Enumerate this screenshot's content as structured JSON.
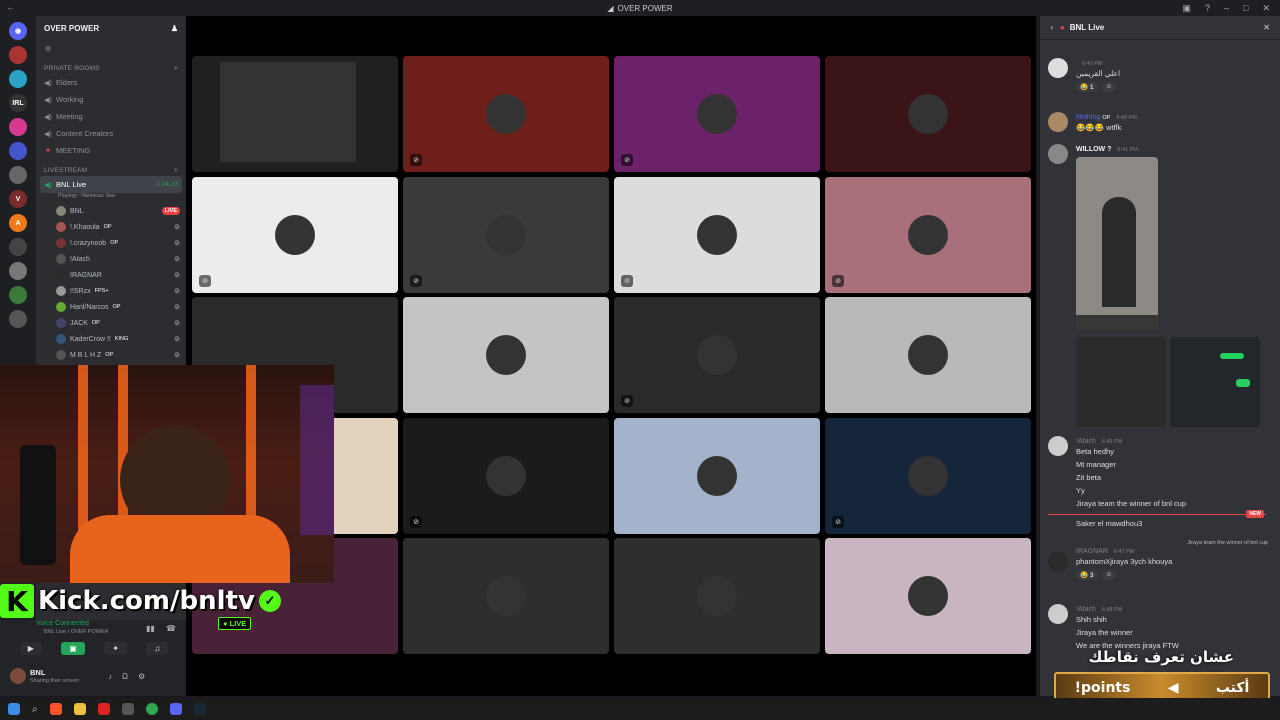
{
  "window": {
    "title": "OVER POWER"
  },
  "server": {
    "name": "OVER POWER"
  },
  "sidebar": {
    "private_category": "PRIVATE ROOMS",
    "private_channels": [
      "Elders",
      "Working",
      "Meeting",
      "Content Creators",
      "MEETING"
    ],
    "livestream_category": "LIVESTREAM",
    "active_channel": {
      "name": "BNL Live",
      "timer": "1:24:23",
      "playing": "Playing: ~Nemesis Star"
    },
    "voice_users": [
      {
        "name": "BNL",
        "badge": "LIVE"
      },
      {
        "name": "!.Khaoula",
        "tag": "OP"
      },
      {
        "name": "!.crazynoob",
        "tag": "OP"
      },
      {
        "name": "!Atach"
      },
      {
        "name": "IRAGNAR"
      },
      {
        "name": "!!SRzx",
        "tag": "FPS+"
      },
      {
        "name": "Hanl/Narcos",
        "tag": "OP"
      },
      {
        "name": "JACK",
        "tag": "OP"
      },
      {
        "name": "KaderCrow !!",
        "tag": "KING"
      },
      {
        "name": "M B L H Z",
        "tag": "OP"
      }
    ]
  },
  "voice": {
    "status": "Voice Connected",
    "location": "BNL Live / OVER POWER"
  },
  "user": {
    "name": "BNL",
    "status": "Sharing their screen"
  },
  "overlay": {
    "handle": "Kick.com/bnltv",
    "live": "LIVE"
  },
  "chat": {
    "title": "BNL Live",
    "messages": [
      {
        "author": "",
        "time": "6:40 PM",
        "text": "اعلي القريمين",
        "reaction": "1"
      },
      {
        "author": "Nothing",
        "tag": "OP",
        "time": "6:40 PM",
        "text": "wtffk"
      },
      {
        "author": "WILLOW ?",
        "time": "6:41 PM",
        "text": ""
      },
      {
        "author": "!Atach",
        "time": "6:46 PM",
        "lines": [
          "Beta hedhy",
          "Mt manager",
          "Zit beta",
          "Yy",
          "Jiraya team the winner of bnl cup",
          "Saker el mawdhou3"
        ],
        "new": "NEW"
      },
      {
        "author": "IRAGNAR",
        "time": "6:47 PM",
        "reply": "Jiraya team the winner of bnl cup",
        "text": "phantomXjiraya 3ych khouya",
        "reaction": "3"
      },
      {
        "author": "!Atach",
        "time": "6:48 PM",
        "lines": [
          "Shih shih",
          "Jiraya the winner",
          "We are the winners jiraya FTW"
        ]
      }
    ]
  },
  "promo": {
    "arabic": "عشان تعرف نقاطك",
    "command": "!points",
    "cta": "أكتب"
  },
  "tile_colors": [
    "#1e1e1e",
    "#6e1f1a",
    "#6b2268",
    "#3b1418",
    "#ececec",
    "#3a3a3a",
    "#dcdcdc",
    "#a8707a",
    "#2a2a2a",
    "#c4c4c4",
    "#2a2a2a",
    "#b9b9b9",
    "#e3d2bd",
    "#1b1b1b",
    "#a3b3cc",
    "#16263a",
    "#4a2238",
    "#2e2e2e",
    "#2e2e2e",
    "#c9b5c1"
  ],
  "accent": "#53fc18"
}
